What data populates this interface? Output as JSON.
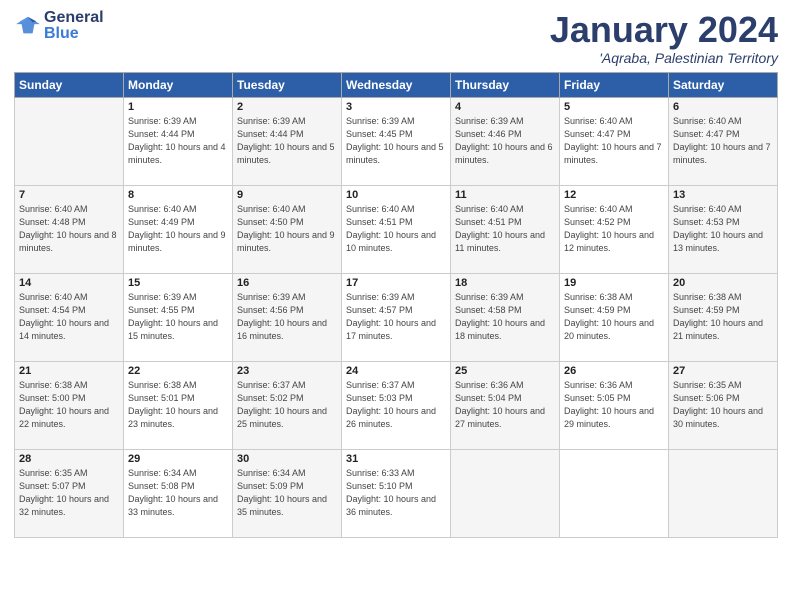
{
  "header": {
    "logo_general": "General",
    "logo_blue": "Blue",
    "month_title": "January 2024",
    "location": "'Aqraba, Palestinian Territory"
  },
  "columns": [
    "Sunday",
    "Monday",
    "Tuesday",
    "Wednesday",
    "Thursday",
    "Friday",
    "Saturday"
  ],
  "weeks": [
    [
      {
        "day": "",
        "sunrise": "",
        "sunset": "",
        "daylight": ""
      },
      {
        "day": "1",
        "sunrise": "Sunrise: 6:39 AM",
        "sunset": "Sunset: 4:44 PM",
        "daylight": "Daylight: 10 hours and 4 minutes."
      },
      {
        "day": "2",
        "sunrise": "Sunrise: 6:39 AM",
        "sunset": "Sunset: 4:44 PM",
        "daylight": "Daylight: 10 hours and 5 minutes."
      },
      {
        "day": "3",
        "sunrise": "Sunrise: 6:39 AM",
        "sunset": "Sunset: 4:45 PM",
        "daylight": "Daylight: 10 hours and 5 minutes."
      },
      {
        "day": "4",
        "sunrise": "Sunrise: 6:39 AM",
        "sunset": "Sunset: 4:46 PM",
        "daylight": "Daylight: 10 hours and 6 minutes."
      },
      {
        "day": "5",
        "sunrise": "Sunrise: 6:40 AM",
        "sunset": "Sunset: 4:47 PM",
        "daylight": "Daylight: 10 hours and 7 minutes."
      },
      {
        "day": "6",
        "sunrise": "Sunrise: 6:40 AM",
        "sunset": "Sunset: 4:47 PM",
        "daylight": "Daylight: 10 hours and 7 minutes."
      }
    ],
    [
      {
        "day": "7",
        "sunrise": "Sunrise: 6:40 AM",
        "sunset": "Sunset: 4:48 PM",
        "daylight": "Daylight: 10 hours and 8 minutes."
      },
      {
        "day": "8",
        "sunrise": "Sunrise: 6:40 AM",
        "sunset": "Sunset: 4:49 PM",
        "daylight": "Daylight: 10 hours and 9 minutes."
      },
      {
        "day": "9",
        "sunrise": "Sunrise: 6:40 AM",
        "sunset": "Sunset: 4:50 PM",
        "daylight": "Daylight: 10 hours and 9 minutes."
      },
      {
        "day": "10",
        "sunrise": "Sunrise: 6:40 AM",
        "sunset": "Sunset: 4:51 PM",
        "daylight": "Daylight: 10 hours and 10 minutes."
      },
      {
        "day": "11",
        "sunrise": "Sunrise: 6:40 AM",
        "sunset": "Sunset: 4:51 PM",
        "daylight": "Daylight: 10 hours and 11 minutes."
      },
      {
        "day": "12",
        "sunrise": "Sunrise: 6:40 AM",
        "sunset": "Sunset: 4:52 PM",
        "daylight": "Daylight: 10 hours and 12 minutes."
      },
      {
        "day": "13",
        "sunrise": "Sunrise: 6:40 AM",
        "sunset": "Sunset: 4:53 PM",
        "daylight": "Daylight: 10 hours and 13 minutes."
      }
    ],
    [
      {
        "day": "14",
        "sunrise": "Sunrise: 6:40 AM",
        "sunset": "Sunset: 4:54 PM",
        "daylight": "Daylight: 10 hours and 14 minutes."
      },
      {
        "day": "15",
        "sunrise": "Sunrise: 6:39 AM",
        "sunset": "Sunset: 4:55 PM",
        "daylight": "Daylight: 10 hours and 15 minutes."
      },
      {
        "day": "16",
        "sunrise": "Sunrise: 6:39 AM",
        "sunset": "Sunset: 4:56 PM",
        "daylight": "Daylight: 10 hours and 16 minutes."
      },
      {
        "day": "17",
        "sunrise": "Sunrise: 6:39 AM",
        "sunset": "Sunset: 4:57 PM",
        "daylight": "Daylight: 10 hours and 17 minutes."
      },
      {
        "day": "18",
        "sunrise": "Sunrise: 6:39 AM",
        "sunset": "Sunset: 4:58 PM",
        "daylight": "Daylight: 10 hours and 18 minutes."
      },
      {
        "day": "19",
        "sunrise": "Sunrise: 6:38 AM",
        "sunset": "Sunset: 4:59 PM",
        "daylight": "Daylight: 10 hours and 20 minutes."
      },
      {
        "day": "20",
        "sunrise": "Sunrise: 6:38 AM",
        "sunset": "Sunset: 4:59 PM",
        "daylight": "Daylight: 10 hours and 21 minutes."
      }
    ],
    [
      {
        "day": "21",
        "sunrise": "Sunrise: 6:38 AM",
        "sunset": "Sunset: 5:00 PM",
        "daylight": "Daylight: 10 hours and 22 minutes."
      },
      {
        "day": "22",
        "sunrise": "Sunrise: 6:38 AM",
        "sunset": "Sunset: 5:01 PM",
        "daylight": "Daylight: 10 hours and 23 minutes."
      },
      {
        "day": "23",
        "sunrise": "Sunrise: 6:37 AM",
        "sunset": "Sunset: 5:02 PM",
        "daylight": "Daylight: 10 hours and 25 minutes."
      },
      {
        "day": "24",
        "sunrise": "Sunrise: 6:37 AM",
        "sunset": "Sunset: 5:03 PM",
        "daylight": "Daylight: 10 hours and 26 minutes."
      },
      {
        "day": "25",
        "sunrise": "Sunrise: 6:36 AM",
        "sunset": "Sunset: 5:04 PM",
        "daylight": "Daylight: 10 hours and 27 minutes."
      },
      {
        "day": "26",
        "sunrise": "Sunrise: 6:36 AM",
        "sunset": "Sunset: 5:05 PM",
        "daylight": "Daylight: 10 hours and 29 minutes."
      },
      {
        "day": "27",
        "sunrise": "Sunrise: 6:35 AM",
        "sunset": "Sunset: 5:06 PM",
        "daylight": "Daylight: 10 hours and 30 minutes."
      }
    ],
    [
      {
        "day": "28",
        "sunrise": "Sunrise: 6:35 AM",
        "sunset": "Sunset: 5:07 PM",
        "daylight": "Daylight: 10 hours and 32 minutes."
      },
      {
        "day": "29",
        "sunrise": "Sunrise: 6:34 AM",
        "sunset": "Sunset: 5:08 PM",
        "daylight": "Daylight: 10 hours and 33 minutes."
      },
      {
        "day": "30",
        "sunrise": "Sunrise: 6:34 AM",
        "sunset": "Sunset: 5:09 PM",
        "daylight": "Daylight: 10 hours and 35 minutes."
      },
      {
        "day": "31",
        "sunrise": "Sunrise: 6:33 AM",
        "sunset": "Sunset: 5:10 PM",
        "daylight": "Daylight: 10 hours and 36 minutes."
      },
      {
        "day": "",
        "sunrise": "",
        "sunset": "",
        "daylight": ""
      },
      {
        "day": "",
        "sunrise": "",
        "sunset": "",
        "daylight": ""
      },
      {
        "day": "",
        "sunrise": "",
        "sunset": "",
        "daylight": ""
      }
    ]
  ]
}
